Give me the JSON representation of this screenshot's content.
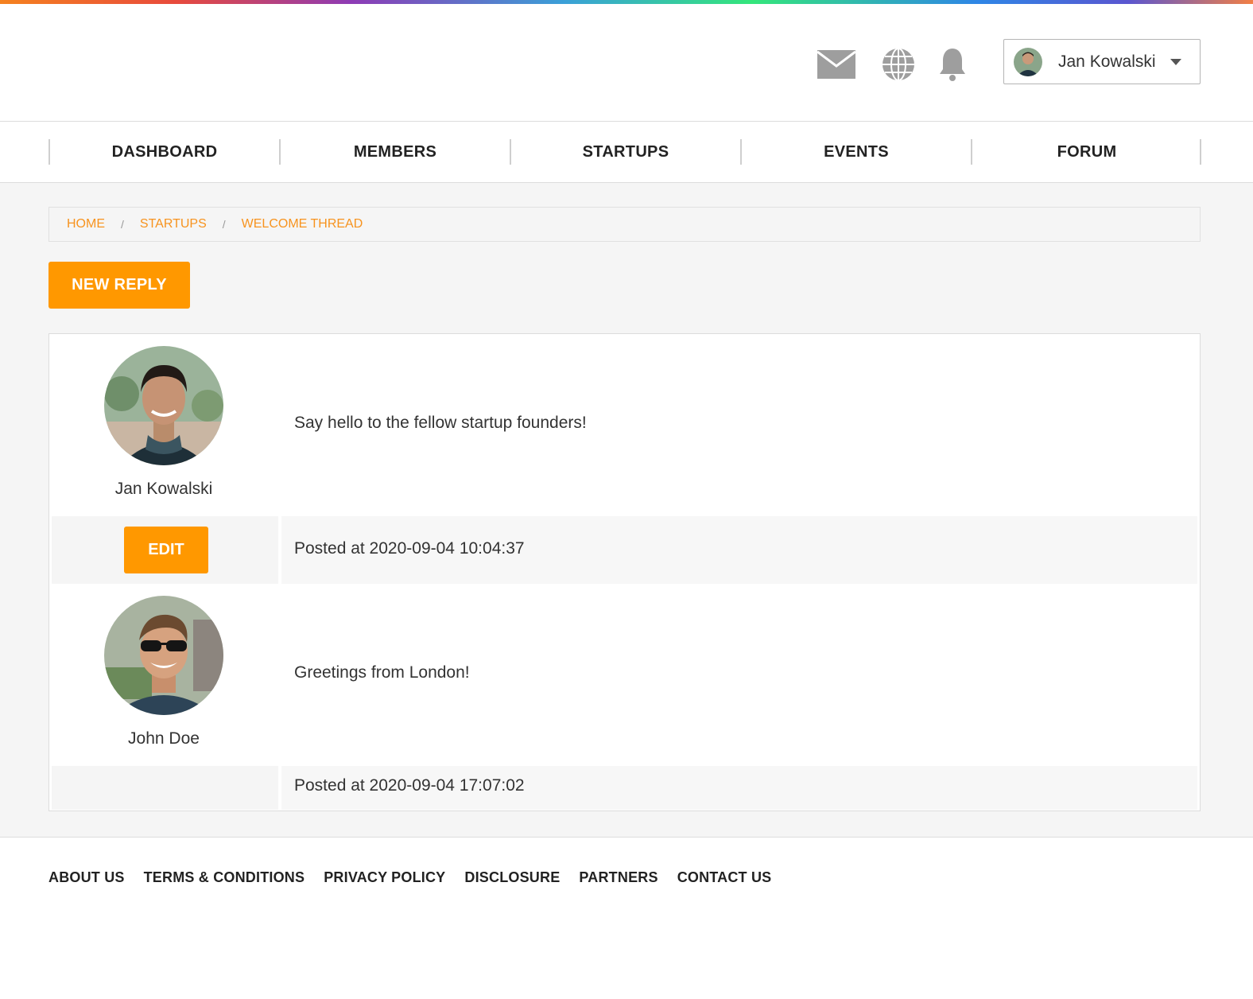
{
  "header": {
    "user_name": "Jan Kowalski",
    "icons": [
      "mail-icon",
      "globe-icon",
      "bell-icon"
    ]
  },
  "nav": {
    "items": [
      "DASHBOARD",
      "MEMBERS",
      "STARTUPS",
      "EVENTS",
      "FORUM"
    ]
  },
  "breadcrumb": {
    "items": [
      "HOME",
      "STARTUPS",
      "WELCOME THREAD"
    ],
    "separator": "/"
  },
  "actions": {
    "new_reply": "NEW REPLY",
    "edit": "EDIT"
  },
  "posts": [
    {
      "author": "Jan Kowalski",
      "message": "Say hello to the fellow startup founders!",
      "posted": "Posted at 2020-09-04 10:04:37"
    },
    {
      "author": "John Doe",
      "message": "Greetings from London!",
      "posted": "Posted at 2020-09-04 17:07:02"
    }
  ],
  "footer": {
    "links": [
      "ABOUT US",
      "TERMS & CONDITIONS",
      "PRIVACY POLICY",
      "DISCLOSURE",
      "PARTNERS",
      "CONTACT US"
    ]
  },
  "colors": {
    "accent": "#ff9800",
    "link": "#f7931e",
    "icon_gray": "#9e9e9e"
  }
}
